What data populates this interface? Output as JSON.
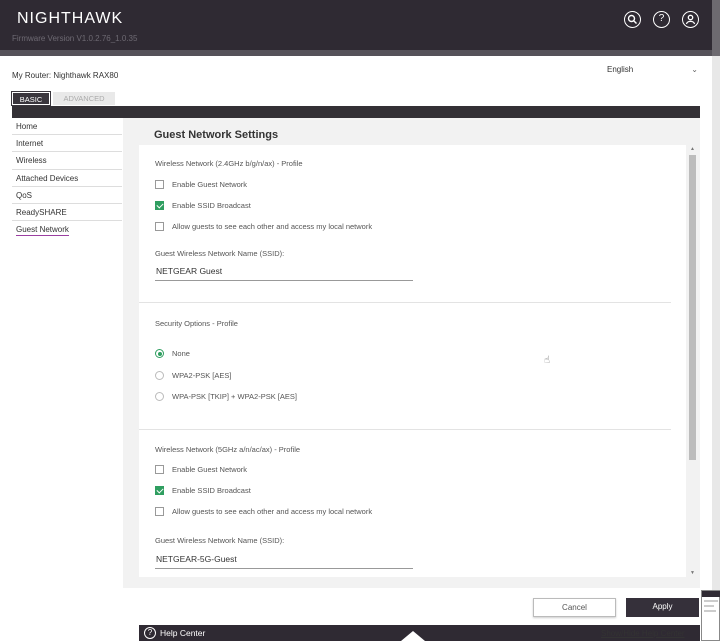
{
  "header": {
    "brand": "NIGHTHAWK",
    "firmware": "Firmware Version V1.0.2.76_1.0.35",
    "icons": [
      "search-icon",
      "help-icon",
      "account-icon"
    ]
  },
  "router": {
    "label": "My Router: Nighthawk RAX80"
  },
  "language": {
    "selected": "English"
  },
  "tabs": [
    {
      "label": "BASIC",
      "active": true
    },
    {
      "label": "ADVANCED",
      "active": false
    }
  ],
  "sidebar": {
    "items": [
      {
        "label": "Home"
      },
      {
        "label": "Internet"
      },
      {
        "label": "Wireless"
      },
      {
        "label": "Attached Devices"
      },
      {
        "label": "QoS"
      },
      {
        "label": "ReadySHARE"
      },
      {
        "label": "Guest Network",
        "active": true
      }
    ]
  },
  "page": {
    "title": "Guest Network Settings"
  },
  "net24": {
    "section": "Wireless Network (2.4GHz b/g/n/ax) - Profile",
    "options": [
      {
        "label": "Enable Guest Network",
        "checked": false
      },
      {
        "label": "Enable SSID Broadcast",
        "checked": true
      },
      {
        "label": "Allow guests to see each other and access my local network",
        "checked": false
      }
    ],
    "ssid_label": "Guest Wireless Network Name (SSID):",
    "ssid_value": "NETGEAR Guest"
  },
  "security": {
    "section": "Security Options - Profile",
    "options": [
      {
        "label": "None",
        "selected": true
      },
      {
        "label": "WPA2-PSK [AES]",
        "selected": false
      },
      {
        "label": "WPA-PSK [TKIP] + WPA2-PSK [AES]",
        "selected": false
      }
    ]
  },
  "net5": {
    "section": "Wireless Network (5GHz a/n/ac/ax) - Profile",
    "options": [
      {
        "label": "Enable Guest Network",
        "checked": false
      },
      {
        "label": "Enable SSID Broadcast",
        "checked": true
      },
      {
        "label": "Allow guests to see each other and access my local network",
        "checked": false
      }
    ],
    "ssid_label": "Guest Wireless Network Name (SSID):",
    "ssid_value": "NETGEAR-5G-Guest"
  },
  "actions": {
    "cancel": "Cancel",
    "apply": "Apply"
  },
  "help": {
    "title": "Help Center",
    "toggle": "Show/Hide Help Center"
  },
  "colors": {
    "header_bg": "#2f2a33",
    "accent_green": "#2f9e60",
    "active_underline": "#9b3fa1"
  }
}
